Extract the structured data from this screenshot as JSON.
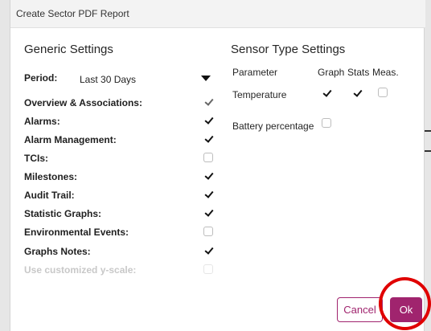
{
  "dialog": {
    "title": "Create Sector PDF Report"
  },
  "generic": {
    "heading": "Generic Settings",
    "period_label": "Period:",
    "period_value": "Last 30 Days",
    "rows": [
      {
        "label": "Overview & Associations:",
        "checked": true,
        "disabled": false
      },
      {
        "label": "Alarms:",
        "checked": true,
        "disabled": false
      },
      {
        "label": "Alarm Management:",
        "checked": true,
        "disabled": false
      },
      {
        "label": "TCIs:",
        "checked": false,
        "disabled": false
      },
      {
        "label": "Milestones:",
        "checked": true,
        "disabled": false
      },
      {
        "label": "Audit Trail:",
        "checked": true,
        "disabled": false
      },
      {
        "label": "Statistic Graphs:",
        "checked": true,
        "disabled": false
      },
      {
        "label": "Environmental Events:",
        "checked": false,
        "disabled": false
      },
      {
        "label": "Graphs Notes:",
        "checked": true,
        "disabled": false
      },
      {
        "label": "Use customized y-scale:",
        "checked": false,
        "disabled": true
      }
    ]
  },
  "sensor": {
    "heading": "Sensor Type Settings",
    "columns": {
      "parameter": "Parameter",
      "graph": "Graph",
      "stats": "Stats",
      "meas": "Meas."
    },
    "params": [
      {
        "name": "Temperature",
        "graph": true,
        "stats": true,
        "meas": false
      },
      {
        "name": "Battery percentage",
        "graph": false
      }
    ]
  },
  "footer": {
    "cancel_label": "Cancel",
    "ok_label": "Ok"
  },
  "colors": {
    "accent": "#a0246e",
    "highlight": "#e00000"
  }
}
